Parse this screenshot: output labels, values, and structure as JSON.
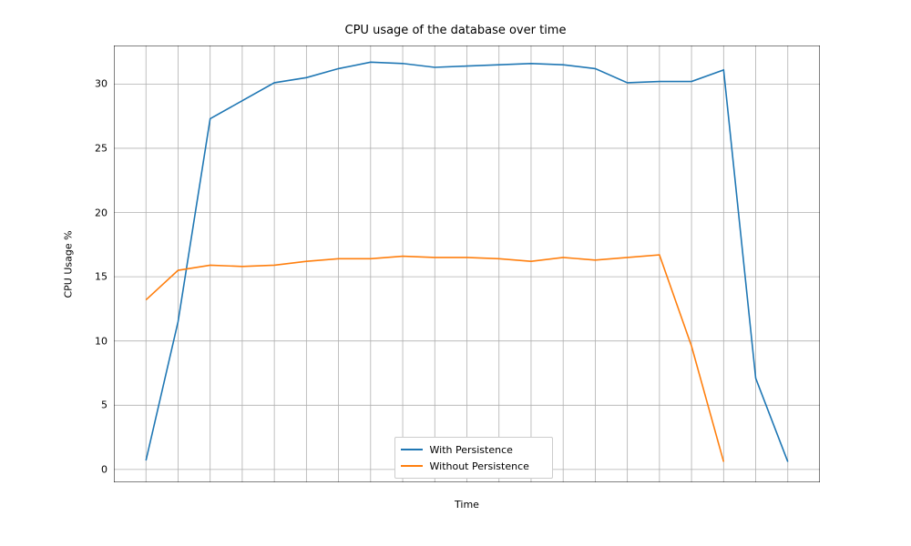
{
  "chart_data": {
    "type": "line",
    "title": "CPU usage of the database over time",
    "xlabel": "Time",
    "ylabel": "CPU Usage %",
    "ylim": [
      -1,
      33
    ],
    "yticks": [
      0,
      5,
      10,
      15,
      20,
      25,
      30
    ],
    "x": [
      0,
      1,
      2,
      3,
      4,
      5,
      6,
      7,
      8,
      9,
      10,
      11,
      12,
      13,
      14,
      15,
      16,
      17,
      18,
      19,
      20
    ],
    "series": [
      {
        "name": "With Persistence",
        "color": "#1f77b4",
        "values": [
          0.7,
          11.5,
          27.3,
          28.7,
          30.1,
          30.5,
          31.2,
          31.7,
          31.6,
          31.3,
          31.4,
          31.5,
          31.6,
          31.5,
          31.2,
          30.1,
          30.2,
          30.2,
          31.1,
          7.1,
          0.6
        ]
      },
      {
        "name": "Without Persistence",
        "color": "#ff7f0e",
        "values": [
          13.2,
          15.5,
          15.9,
          15.8,
          15.9,
          16.2,
          16.4,
          16.4,
          16.6,
          16.5,
          16.5,
          16.4,
          16.2,
          16.5,
          16.3,
          16.5,
          16.7,
          9.6,
          0.6
        ]
      }
    ],
    "legend_position": "lower center"
  }
}
